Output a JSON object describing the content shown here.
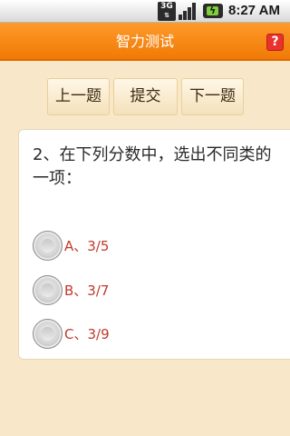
{
  "status_bar": {
    "network_label": "3G",
    "time": "8:27 AM",
    "battery_color": "#7fcf3a"
  },
  "title_bar": {
    "title": "智力测试",
    "help_label": "?",
    "accent_color": "#f58b14"
  },
  "toolbar": {
    "prev_label": "上一题",
    "submit_label": "提交",
    "next_label": "下一题"
  },
  "question": {
    "text": "2、在下列分数中，选出不同类的一项：",
    "options": [
      {
        "label": "A、3/5",
        "selected": false
      },
      {
        "label": "B、3/7",
        "selected": false
      },
      {
        "label": "C、3/9",
        "selected": false
      }
    ],
    "option_text_color": "#c0392b"
  }
}
